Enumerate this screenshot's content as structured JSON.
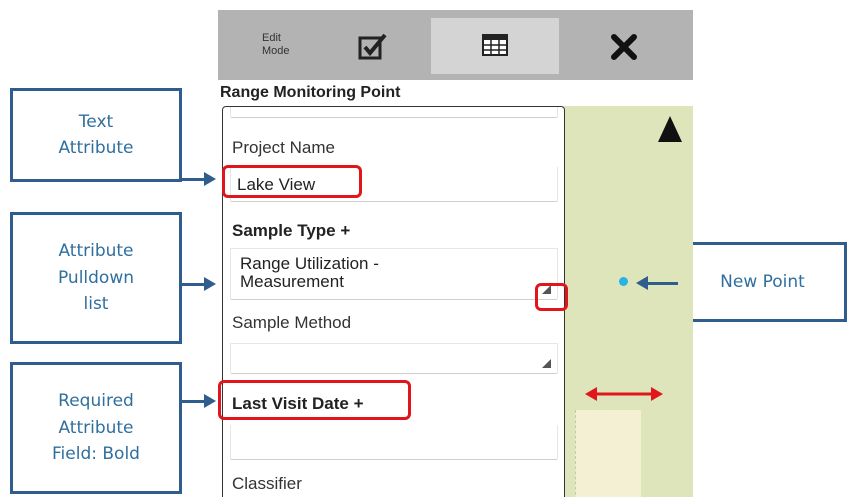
{
  "callouts": {
    "text_attribute": "Text\nAttribute",
    "pulldown": "Attribute\nPulldown\nlist",
    "required": "Required\nAttribute\nField: Bold",
    "new_point": "New Point"
  },
  "toolbar": {
    "edit_mode_label": "Edit\nMode",
    "check_icon": "check-square-icon",
    "table_icon": "table-icon",
    "close_icon": "close-icon"
  },
  "form": {
    "title": "Range Monitoring Point",
    "project_name": {
      "label": "Project Name",
      "value": "Lake View"
    },
    "sample_type": {
      "label": "Sample Type +",
      "value": "Range Utilization -\nMeasurement"
    },
    "sample_method": {
      "label": "Sample Method",
      "value": ""
    },
    "last_visit_date": {
      "label": "Last Visit Date +",
      "value": ""
    },
    "classifier": {
      "label": "Classifier"
    }
  },
  "colors": {
    "callout_border": "#2f5e8e",
    "callout_text": "#2f6f9f",
    "highlight": "#e0161c",
    "map": "#dfe5bb",
    "point": "#27b3e6"
  }
}
